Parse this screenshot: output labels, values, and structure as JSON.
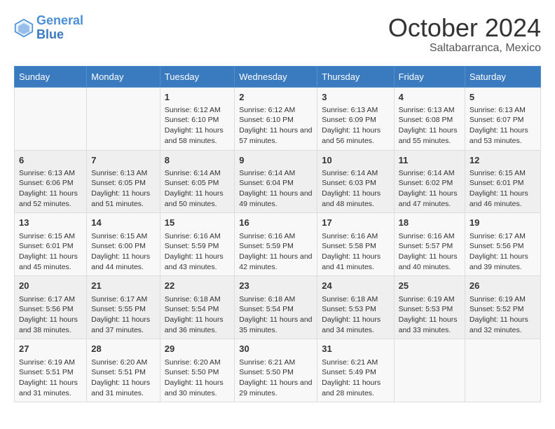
{
  "header": {
    "logo_line1": "General",
    "logo_line2": "Blue",
    "month": "October 2024",
    "location": "Saltabarranca, Mexico"
  },
  "days_of_week": [
    "Sunday",
    "Monday",
    "Tuesday",
    "Wednesday",
    "Thursday",
    "Friday",
    "Saturday"
  ],
  "weeks": [
    [
      {
        "day": "",
        "content": ""
      },
      {
        "day": "",
        "content": ""
      },
      {
        "day": "1",
        "content": "Sunrise: 6:12 AM\nSunset: 6:10 PM\nDaylight: 11 hours and 58 minutes."
      },
      {
        "day": "2",
        "content": "Sunrise: 6:12 AM\nSunset: 6:10 PM\nDaylight: 11 hours and 57 minutes."
      },
      {
        "day": "3",
        "content": "Sunrise: 6:13 AM\nSunset: 6:09 PM\nDaylight: 11 hours and 56 minutes."
      },
      {
        "day": "4",
        "content": "Sunrise: 6:13 AM\nSunset: 6:08 PM\nDaylight: 11 hours and 55 minutes."
      },
      {
        "day": "5",
        "content": "Sunrise: 6:13 AM\nSunset: 6:07 PM\nDaylight: 11 hours and 53 minutes."
      }
    ],
    [
      {
        "day": "6",
        "content": "Sunrise: 6:13 AM\nSunset: 6:06 PM\nDaylight: 11 hours and 52 minutes."
      },
      {
        "day": "7",
        "content": "Sunrise: 6:13 AM\nSunset: 6:05 PM\nDaylight: 11 hours and 51 minutes."
      },
      {
        "day": "8",
        "content": "Sunrise: 6:14 AM\nSunset: 6:05 PM\nDaylight: 11 hours and 50 minutes."
      },
      {
        "day": "9",
        "content": "Sunrise: 6:14 AM\nSunset: 6:04 PM\nDaylight: 11 hours and 49 minutes."
      },
      {
        "day": "10",
        "content": "Sunrise: 6:14 AM\nSunset: 6:03 PM\nDaylight: 11 hours and 48 minutes."
      },
      {
        "day": "11",
        "content": "Sunrise: 6:14 AM\nSunset: 6:02 PM\nDaylight: 11 hours and 47 minutes."
      },
      {
        "day": "12",
        "content": "Sunrise: 6:15 AM\nSunset: 6:01 PM\nDaylight: 11 hours and 46 minutes."
      }
    ],
    [
      {
        "day": "13",
        "content": "Sunrise: 6:15 AM\nSunset: 6:01 PM\nDaylight: 11 hours and 45 minutes."
      },
      {
        "day": "14",
        "content": "Sunrise: 6:15 AM\nSunset: 6:00 PM\nDaylight: 11 hours and 44 minutes."
      },
      {
        "day": "15",
        "content": "Sunrise: 6:16 AM\nSunset: 5:59 PM\nDaylight: 11 hours and 43 minutes."
      },
      {
        "day": "16",
        "content": "Sunrise: 6:16 AM\nSunset: 5:59 PM\nDaylight: 11 hours and 42 minutes."
      },
      {
        "day": "17",
        "content": "Sunrise: 6:16 AM\nSunset: 5:58 PM\nDaylight: 11 hours and 41 minutes."
      },
      {
        "day": "18",
        "content": "Sunrise: 6:16 AM\nSunset: 5:57 PM\nDaylight: 11 hours and 40 minutes."
      },
      {
        "day": "19",
        "content": "Sunrise: 6:17 AM\nSunset: 5:56 PM\nDaylight: 11 hours and 39 minutes."
      }
    ],
    [
      {
        "day": "20",
        "content": "Sunrise: 6:17 AM\nSunset: 5:56 PM\nDaylight: 11 hours and 38 minutes."
      },
      {
        "day": "21",
        "content": "Sunrise: 6:17 AM\nSunset: 5:55 PM\nDaylight: 11 hours and 37 minutes."
      },
      {
        "day": "22",
        "content": "Sunrise: 6:18 AM\nSunset: 5:54 PM\nDaylight: 11 hours and 36 minutes."
      },
      {
        "day": "23",
        "content": "Sunrise: 6:18 AM\nSunset: 5:54 PM\nDaylight: 11 hours and 35 minutes."
      },
      {
        "day": "24",
        "content": "Sunrise: 6:18 AM\nSunset: 5:53 PM\nDaylight: 11 hours and 34 minutes."
      },
      {
        "day": "25",
        "content": "Sunrise: 6:19 AM\nSunset: 5:53 PM\nDaylight: 11 hours and 33 minutes."
      },
      {
        "day": "26",
        "content": "Sunrise: 6:19 AM\nSunset: 5:52 PM\nDaylight: 11 hours and 32 minutes."
      }
    ],
    [
      {
        "day": "27",
        "content": "Sunrise: 6:19 AM\nSunset: 5:51 PM\nDaylight: 11 hours and 31 minutes."
      },
      {
        "day": "28",
        "content": "Sunrise: 6:20 AM\nSunset: 5:51 PM\nDaylight: 11 hours and 31 minutes."
      },
      {
        "day": "29",
        "content": "Sunrise: 6:20 AM\nSunset: 5:50 PM\nDaylight: 11 hours and 30 minutes."
      },
      {
        "day": "30",
        "content": "Sunrise: 6:21 AM\nSunset: 5:50 PM\nDaylight: 11 hours and 29 minutes."
      },
      {
        "day": "31",
        "content": "Sunrise: 6:21 AM\nSunset: 5:49 PM\nDaylight: 11 hours and 28 minutes."
      },
      {
        "day": "",
        "content": ""
      },
      {
        "day": "",
        "content": ""
      }
    ]
  ]
}
